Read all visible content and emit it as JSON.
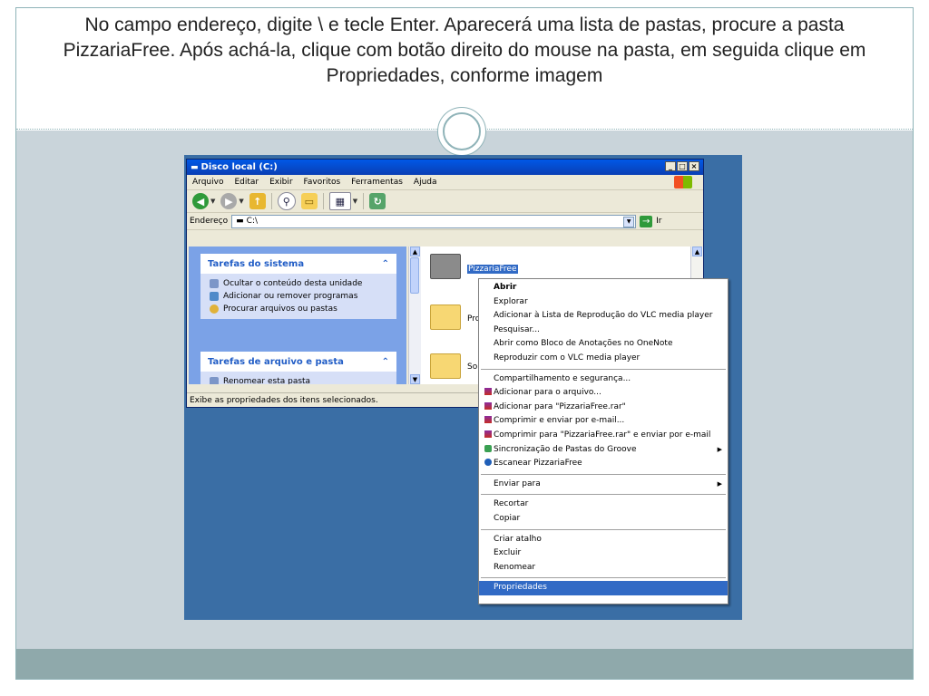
{
  "slide": {
    "title": "No campo endereço, digite \\ e tecle Enter. Aparecerá uma lista de pastas, procure a pasta PizzariaFree. Após achá-la, clique com botão direito do mouse na pasta, em seguida clique em Propriedades, conforme imagem"
  },
  "window": {
    "title": "Disco local (C:)",
    "buttons": {
      "minimize": "_",
      "maximize": "□",
      "close": "×"
    },
    "menu": [
      "Arquivo",
      "Editar",
      "Exibir",
      "Favoritos",
      "Ferramentas",
      "Ajuda"
    ],
    "address_label": "Endereço",
    "address_value": "C:\\",
    "go_label": "Ir",
    "status": "Exibe as propriedades dos itens selecionados."
  },
  "left_pane": {
    "system_tasks": {
      "title": "Tarefas do sistema",
      "items": [
        "Ocultar o conteúdo desta unidade",
        "Adicionar ou remover programas",
        "Procurar arquivos ou pastas"
      ]
    },
    "file_tasks": {
      "title": "Tarefas de arquivo e pasta",
      "items": [
        "Renomear esta pasta"
      ]
    },
    "collapse_glyph": "⌃"
  },
  "folders": [
    {
      "label": "PizzariaFree",
      "selected": true
    },
    {
      "label": "Pro"
    },
    {
      "label": "Sol"
    }
  ],
  "context_menu": {
    "group1": [
      "Abrir",
      "Explorar",
      "Adicionar à Lista de Reprodução do VLC media player",
      "Pesquisar...",
      "Abrir como Bloco de Anotações no OneNote",
      "Reproduzir com o VLC media player"
    ],
    "group2": [
      "Compartilhamento e segurança...",
      "Adicionar para o arquivo...",
      "Adicionar para \"PizzariaFree.rar\"",
      "Comprimir e enviar por e-mail...",
      "Comprimir para \"PizzariaFree.rar\" e enviar por e-mail",
      "Sincronização de Pastas do Groove",
      "Escanear PizzariaFree"
    ],
    "group3": [
      "Enviar para"
    ],
    "group4": [
      "Recortar",
      "Copiar"
    ],
    "group5": [
      "Criar atalho",
      "Excluir",
      "Renomear"
    ],
    "group6": [
      "Propriedades"
    ]
  },
  "colors": {
    "accent": "#8fb3b8",
    "desktop": "#3a6ea5",
    "selection": "#316ac5"
  }
}
